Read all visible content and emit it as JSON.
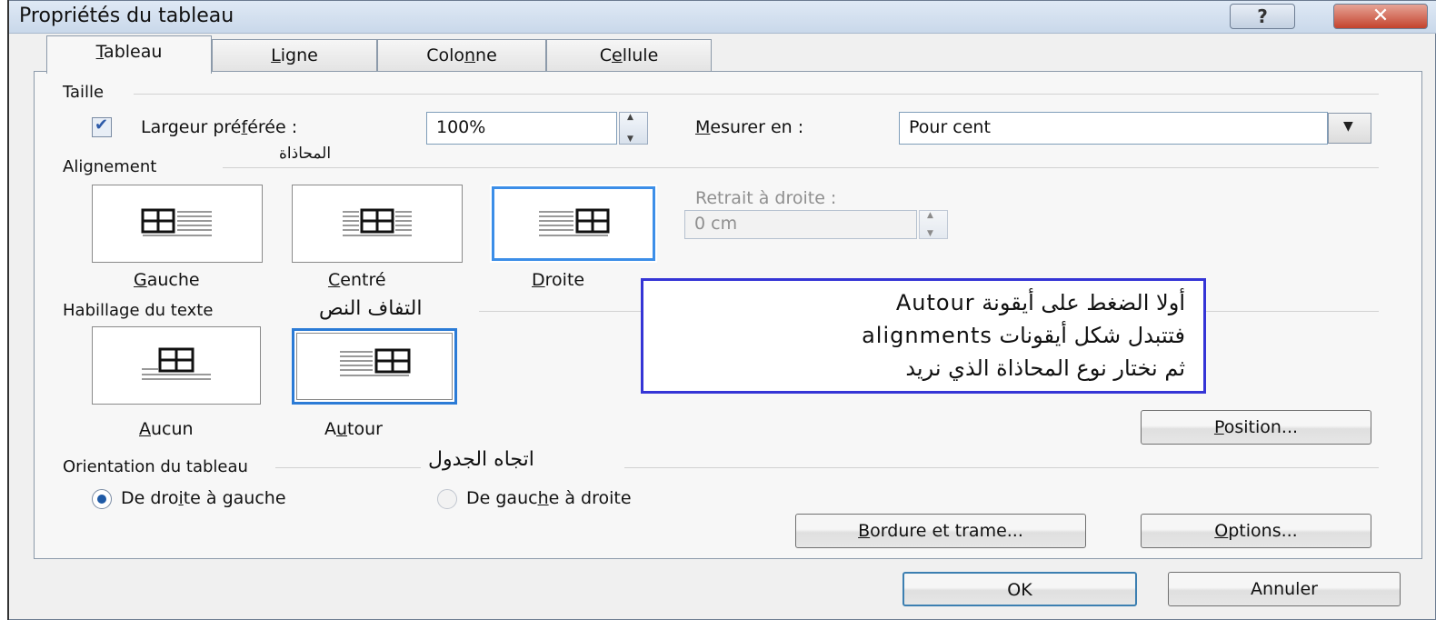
{
  "window": {
    "title": "Propriétés du tableau",
    "help_label": "?",
    "close_label": "✕"
  },
  "tabs": [
    {
      "pre": "",
      "key": "T",
      "post": "ableau"
    },
    {
      "pre": "",
      "key": "L",
      "post": "igne"
    },
    {
      "pre": "Colo",
      "key": "n",
      "post": "ne"
    },
    {
      "pre": "C",
      "key": "e",
      "post": "llule"
    }
  ],
  "size": {
    "heading": "Taille",
    "preferred_width_pre": "Largeur pré",
    "preferred_width_key": "f",
    "preferred_width_post": "érée :",
    "width_value": "100%",
    "measure_key": "M",
    "measure_post": "esurer en :",
    "measure_value": "Pour cent"
  },
  "alignment": {
    "heading": "Alignement",
    "arabic_note": "المحاذاة",
    "indent_label": "Retrait à droite :",
    "indent_value": "0 cm",
    "options": [
      {
        "key": "G",
        "post": "auche"
      },
      {
        "key": "C",
        "post": "entré"
      },
      {
        "key": "D",
        "post": "roite"
      }
    ]
  },
  "wrapping": {
    "heading": "Habillage du texte",
    "arabic_note": "التفاف النص",
    "options": [
      {
        "pre": "",
        "key": "A",
        "post": "ucun"
      },
      {
        "pre": "A",
        "key": "u",
        "post": "tour"
      }
    ],
    "position_key": "P",
    "position_post": "osition..."
  },
  "callout": {
    "line1": "أولا الضغط على أيقونة Autour",
    "line2": "فتتبدل شكل أيقونات  alignments",
    "line3": "ثم نختار نوع المحاذاة الذي نريد"
  },
  "orientation": {
    "heading": "Orientation du tableau",
    "arabic_note": "اتجاه الجدول",
    "rtl_pre": "De dro",
    "rtl_key": "i",
    "rtl_post": "te à gauche",
    "ltr_pre": "De gauc",
    "ltr_key": "h",
    "ltr_post": "e à droite"
  },
  "buttons": {
    "borders_key": "B",
    "borders_post": "ordure et trame...",
    "options_key": "O",
    "options_post": "ptions...",
    "ok": "OK",
    "cancel": "Annuler"
  }
}
